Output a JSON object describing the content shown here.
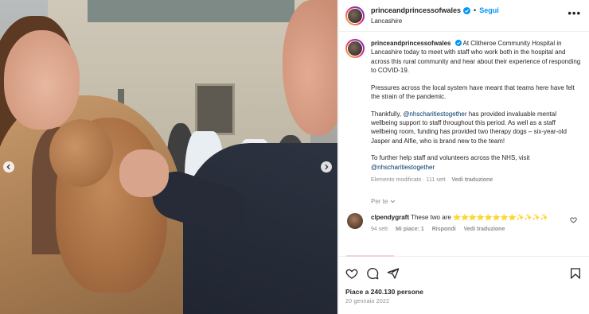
{
  "post": {
    "username": "princeandprincessofwales",
    "follow_label": "Segui",
    "separator": "•",
    "location": "Lancashire",
    "more_label": "•••"
  },
  "caption": {
    "username": "princeandprincessofwales",
    "para1_text": "At Clitheroe Community Hospital in Lancashire today to meet with staff who work both in the hospital and across this rural community and hear about their experience of responding to COVID-19.",
    "para2": "Pressures across the local system have meant that teams here have felt the strain of the pandemic.",
    "para3_pre": "Thankfully, ",
    "para3_mention": "@nhscharitiestogether",
    "para3_post": " has provided invaluable mental wellbeing support to staff throughout this period. As well as a staff wellbeing room, funding has provided two therapy dogs – six-year-old Jasper and Alfie, who is brand new to the team!",
    "para4_pre": "To further help staff and volunteers across the NHS, visit ",
    "para4_mention": "@nhscharitiestogether",
    "edited_label": "Elemento modificato",
    "meta_sep": "·",
    "age": "111 sett",
    "translate_label": "Vedi traduzione"
  },
  "translate_toggle": {
    "label": "Per te"
  },
  "comments": [
    {
      "username": "clpendygraft",
      "text": "These two are ⭐⭐⭐⭐⭐⭐⭐⭐✨✨✨✨",
      "age": "94 sett",
      "likes": "Mi piace: 1",
      "reply": "Rispondi",
      "translate": "Vedi traduzione"
    }
  ],
  "footer": {
    "likes_text": "Piace a 240.130 persone",
    "date": "20 gennaio 2022"
  },
  "icons": {
    "verified_color": "#0095f6",
    "accent": "#0095f6"
  }
}
